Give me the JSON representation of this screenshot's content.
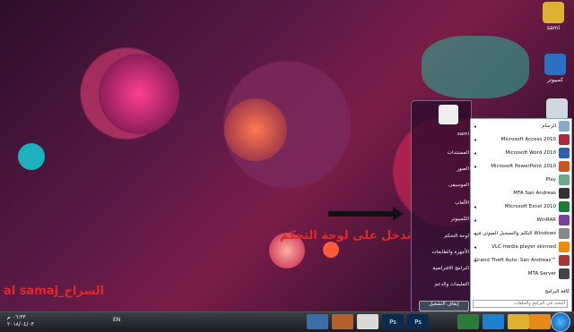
{
  "desktop": {
    "icons": [
      {
        "label": "sami",
        "icon": "folder-icon",
        "color": "#e0b030"
      },
      {
        "label": "كمبيوتر",
        "icon": "computer-icon",
        "color": "#2a6fc0"
      },
      {
        "label": "",
        "icon": "recycle-bin-icon",
        "color": "#cfd8e0"
      }
    ],
    "caption": "ندخل على لوحة التحكم",
    "watermark": "al samaj_السراج"
  },
  "start_menu": {
    "user_name": "sami",
    "right_links": [
      "المستندات",
      "الصور",
      "الموسيقى",
      "الألعاب",
      "الكمبيوتر",
      "لوحة التحكم",
      "الأجهزة والطابعات",
      "البرامج الافتراضية",
      "التعليمات والدعم"
    ],
    "programs": [
      {
        "label": "الرسام",
        "icon": "paint-icon",
        "color": "#8ac"
      },
      {
        "label": "Microsoft Access 2010",
        "icon": "access-icon",
        "color": "#b0263a"
      },
      {
        "label": "Microsoft Word 2010",
        "icon": "word-icon",
        "color": "#2b5fb5"
      },
      {
        "label": "Microsoft PowerPoint 2010",
        "icon": "powerpoint-icon",
        "color": "#d2531e"
      },
      {
        "label": "Play",
        "icon": "play-icon",
        "color": "#6a8"
      },
      {
        "label": "MTA San Andreas",
        "icon": "mta-icon",
        "color": "#333"
      },
      {
        "label": "Microsoft Excel 2010",
        "icon": "excel-icon",
        "color": "#1f7a3a"
      },
      {
        "label": "WinRAR",
        "icon": "winrar-icon",
        "color": "#7a3fa0"
      },
      {
        "label": "التكلم والتسجيل الصوتي في Windows",
        "icon": "speech-icon",
        "color": "#888"
      },
      {
        "label": "VLC media player skinned",
        "icon": "vlc-icon",
        "color": "#f08a00"
      },
      {
        "label": "Grand Theft Auto: San Andreas™",
        "icon": "gta-icon",
        "color": "#a33"
      },
      {
        "label": "MTA Server",
        "icon": "mta-server-icon",
        "color": "#444"
      }
    ],
    "all_programs": "كافة البرامج",
    "search_placeholder": "البحث في البرامج والملفات",
    "shutdown": "إيقاف التشغيل"
  },
  "taskbar": {
    "clock_time": "٠٦:٣٣ م",
    "clock_date": "٢٠١٨/٠٤/٠٣",
    "language": "EN",
    "items": [
      {
        "icon": "display-icon",
        "color": "#3a6ea5"
      },
      {
        "icon": "media-icon",
        "color": "#b5602a"
      },
      {
        "icon": "chrome-icon",
        "color": "#d9d9d9"
      },
      {
        "icon": "photoshop-icon",
        "color": "#0a2a4f",
        "text": "Ps"
      },
      {
        "icon": "photoshop-icon",
        "color": "#0a2a4f",
        "text": "Ps"
      },
      {
        "icon": "camtasia-icon",
        "color": "#2a7a3a"
      },
      {
        "icon": "ie-icon",
        "color": "#1e7fd0"
      },
      {
        "icon": "explorer-folder-icon",
        "color": "#e0b030"
      },
      {
        "icon": "media-player-icon",
        "color": "#e58a1a"
      }
    ]
  }
}
